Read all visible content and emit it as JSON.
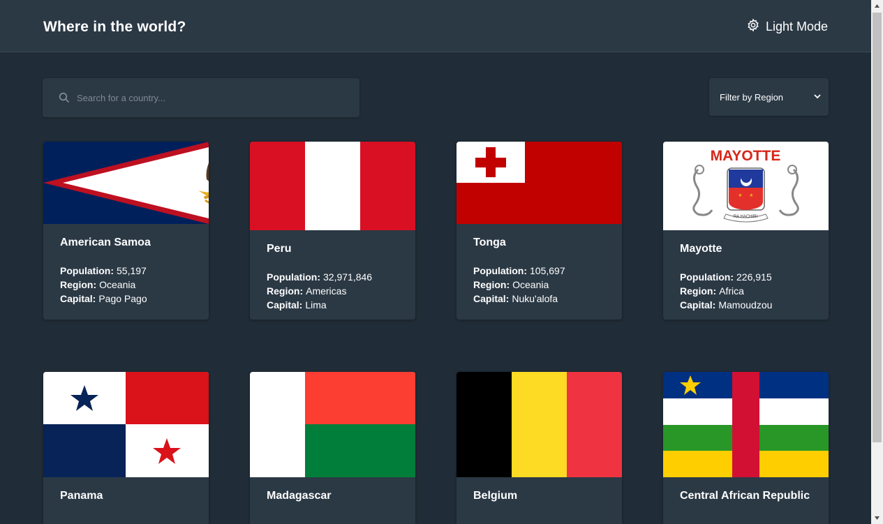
{
  "header": {
    "title": "Where in the world?",
    "mode_label": "Light Mode",
    "mode_icon": "gear-icon"
  },
  "search": {
    "placeholder": "Search for a country...",
    "icon": "search-icon"
  },
  "filter": {
    "label": "Filter by Region",
    "icon": "chevron-down-icon"
  },
  "labels": {
    "population": "Population:",
    "region": "Region:",
    "capital": "Capital:"
  },
  "countries": [
    {
      "name": "American Samoa",
      "population": "55,197",
      "region": "Oceania",
      "capital": "Pago Pago",
      "flag": "american-samoa-flag"
    },
    {
      "name": "Peru",
      "population": "32,971,846",
      "region": "Americas",
      "capital": "Lima",
      "flag": "peru-flag"
    },
    {
      "name": "Tonga",
      "population": "105,697",
      "region": "Oceania",
      "capital": "Nuku'alofa",
      "flag": "tonga-flag"
    },
    {
      "name": "Mayotte",
      "population": "226,915",
      "region": "Africa",
      "capital": "Mamoudzou",
      "flag": "mayotte-flag",
      "flag_text": "MAYOTTE",
      "flag_motto": "RA HACHIRI"
    },
    {
      "name": "Panama",
      "flag": "panama-flag"
    },
    {
      "name": "Madagascar",
      "flag": "madagascar-flag"
    },
    {
      "name": "Belgium",
      "flag": "belgium-flag"
    },
    {
      "name": "Central African Republic",
      "flag": "central-african-republic-flag"
    }
  ],
  "colors": {
    "background": "#202c37",
    "element": "#2b3945",
    "text": "#ffffff"
  }
}
